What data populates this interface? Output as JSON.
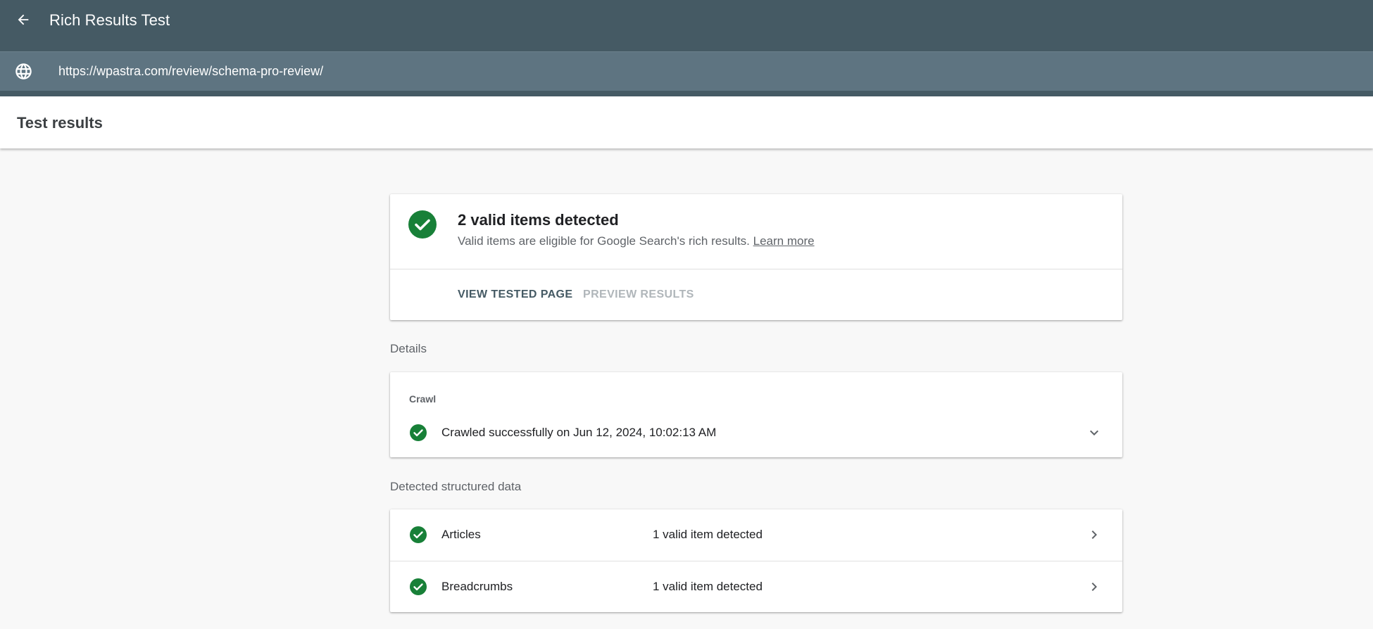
{
  "header": {
    "title": "Rich Results Test",
    "back_icon": "arrow-back-icon",
    "url": "https://wpastra.com/review/schema-pro-review/",
    "url_icon": "globe-icon"
  },
  "subheader": {
    "title": "Test results"
  },
  "summary": {
    "heading": "2 valid items detected",
    "description": "Valid items are eligible for Google Search's rich results.",
    "learn_more": "Learn more",
    "view_tested_page": "VIEW TESTED PAGE",
    "preview_results": "PREVIEW RESULTS"
  },
  "details": {
    "label": "Details",
    "crawl_heading": "Crawl",
    "crawl_status": "Crawled successfully on Jun 12, 2024, 10:02:13 AM"
  },
  "structured_data": {
    "label": "Detected structured data",
    "items": [
      {
        "name": "Articles",
        "status": "1 valid item detected"
      },
      {
        "name": "Breadcrumbs",
        "status": "1 valid item detected"
      }
    ]
  },
  "colors": {
    "header_bg": "#455a64",
    "url_bar_bg": "#5e7481",
    "success_green": "#188038",
    "page_bg": "#f8f8f8"
  }
}
